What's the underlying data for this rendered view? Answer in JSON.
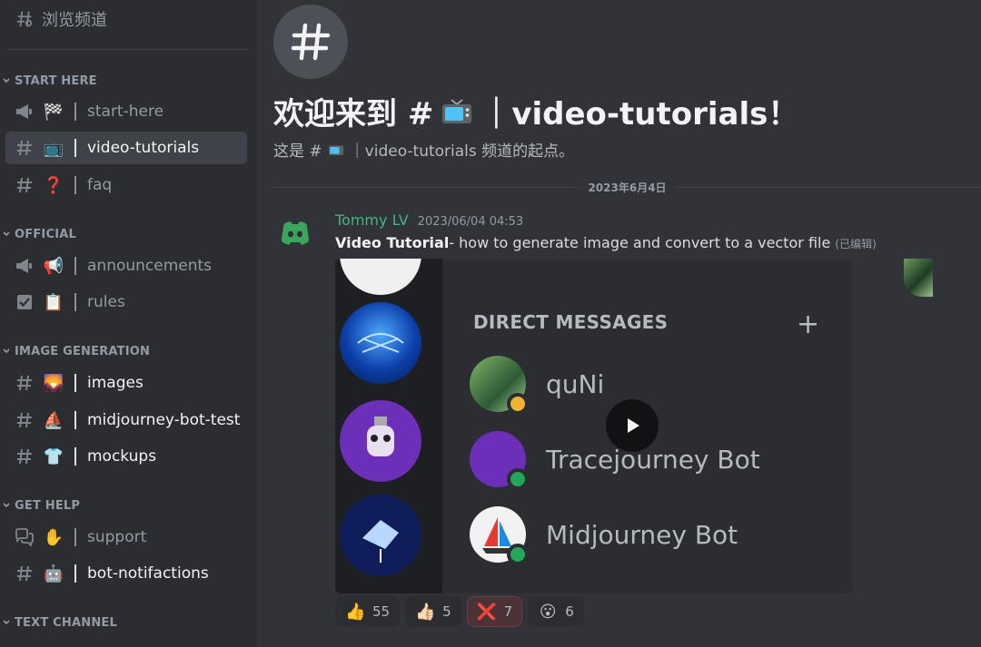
{
  "sidebar": {
    "browse_label": "浏览频道",
    "categories": [
      {
        "name": "START HERE"
      },
      {
        "name": "OFFICIAL"
      },
      {
        "name": "IMAGE GENERATION"
      },
      {
        "name": "GET HELP"
      },
      {
        "name": "TEXT CHANNEL"
      }
    ],
    "channels": [
      {
        "name": "start-here",
        "icon": "megaphone-icon",
        "emoji": "🏁"
      },
      {
        "name": "video-tutorials",
        "icon": "hash-icon",
        "emoji": "📺",
        "active": true
      },
      {
        "name": "faq",
        "icon": "hash-icon",
        "emoji": "❓"
      },
      {
        "name": "announcements",
        "icon": "megaphone-icon",
        "emoji": "📢"
      },
      {
        "name": "rules",
        "icon": "rules-icon",
        "emoji": "📋"
      },
      {
        "name": "images",
        "icon": "hash-icon",
        "emoji": "🌄"
      },
      {
        "name": "midjourney-bot-test",
        "icon": "hash-icon",
        "emoji": "⛵"
      },
      {
        "name": "mockups",
        "icon": "hash-icon",
        "emoji": "👕"
      },
      {
        "name": "support",
        "icon": "forum-icon",
        "emoji": "✋"
      },
      {
        "name": "bot-notifactions",
        "icon": "hash-icon",
        "emoji": "🤖"
      }
    ]
  },
  "main": {
    "welcome_prefix": "欢迎来到 #",
    "welcome_suffix": "｜video-tutorials！",
    "subtitle_prefix": "这是 #",
    "subtitle_suffix": "｜video-tutorials 频道的起点。",
    "date_divider": "2023年6月4日",
    "message": {
      "author": "Tommy LV",
      "timestamp": "2023/06/04 04:53",
      "bold_text": "Video Tutorial",
      "text": "- how to generate image and convert to a vector file",
      "edited": "(已编辑)"
    },
    "video": {
      "dm_title": "DIRECT MESSAGES",
      "dm_plus": "+",
      "dm_items": [
        {
          "name": "quNi"
        },
        {
          "name": "Tracejourney Bot"
        },
        {
          "name": "Midjourney Bot"
        }
      ]
    },
    "reactions": [
      {
        "emoji": "👍",
        "count": "55"
      },
      {
        "emoji": "👍🏻",
        "count": "5"
      },
      {
        "emoji": "❌",
        "count": "7"
      },
      {
        "emoji": "😮",
        "count": "6"
      }
    ],
    "colors": {
      "author": "#43b581",
      "accent": "#5865f2"
    }
  }
}
